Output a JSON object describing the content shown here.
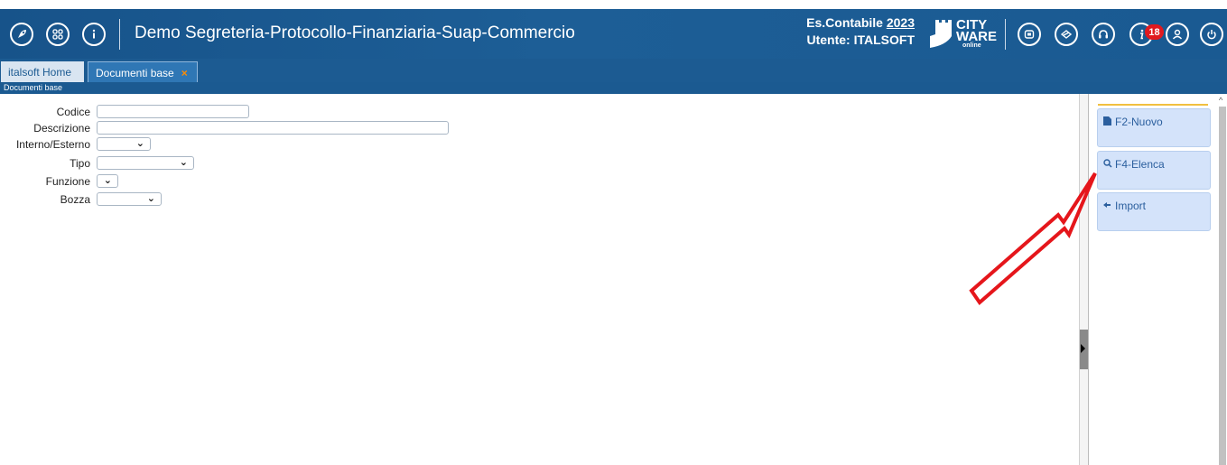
{
  "header": {
    "app_title": "Demo Segreteria-Protocollo-Finanziaria-Suap-Commercio",
    "fiscal_year_label": "Es.Contabile",
    "fiscal_year": "2023",
    "user_label": "Utente: ITALSOFT",
    "logo_line1": "CITY",
    "logo_line2": "WARE",
    "logo_line3": "online",
    "notifications_count": "18",
    "left_icons": [
      "rocket-icon",
      "apps-grid-icon",
      "info-menu-icon"
    ],
    "right_icons": [
      "windows-icon",
      "layers-icon",
      "headset-icon",
      "info-icon",
      "user-icon",
      "power-icon"
    ]
  },
  "tabs": [
    {
      "label": "italsoft Home",
      "active": false
    },
    {
      "label": "Documenti base",
      "active": true,
      "close": "×"
    }
  ],
  "breadcrumb": "Documenti base",
  "form": {
    "codice_label": "Codice",
    "codice_value": "",
    "descrizione_label": "Descrizione",
    "descrizione_value": "",
    "interno_label": "Interno/Esterno",
    "interno_value": "",
    "tipo_label": "Tipo",
    "tipo_value": "",
    "funzione_label": "Funzione",
    "funzione_value": "",
    "bozza_label": "Bozza",
    "bozza_value": ""
  },
  "actions": [
    {
      "label": "F2-Nuovo",
      "icon": "document-icon"
    },
    {
      "label": "F4-Elenca",
      "icon": "search-icon"
    },
    {
      "label": "Import",
      "icon": "import-icon"
    }
  ],
  "colors": {
    "header_bg": "#1d5e96",
    "action_bg": "#d4e3fa",
    "annotation_arrow": "#e5161b"
  }
}
